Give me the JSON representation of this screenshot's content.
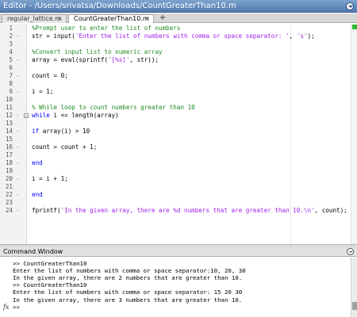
{
  "editor": {
    "title": "Editor - /Users/srivatsa/Downloads/CountGreaterThan10.m",
    "tabs": [
      {
        "label": "regular_lattice.m",
        "close": "×"
      },
      {
        "label": "CountGreaterThan10.m",
        "close": "×"
      }
    ],
    "add_tab": "+",
    "lines": [
      {
        "num": "1",
        "dash": "",
        "parts": [
          {
            "t": "%Prompt user to enter the list of numbers",
            "c": "cmt"
          }
        ]
      },
      {
        "num": "2",
        "dash": "-",
        "parts": [
          {
            "t": "str = input(",
            "c": ""
          },
          {
            "t": "'Enter the list of numbers with comma or space separator: '",
            "c": "str"
          },
          {
            "t": ", ",
            "c": ""
          },
          {
            "t": "'s'",
            "c": "str"
          },
          {
            "t": ");",
            "c": ""
          }
        ]
      },
      {
        "num": "3",
        "dash": "",
        "parts": []
      },
      {
        "num": "4",
        "dash": "",
        "parts": [
          {
            "t": "%Convert input list to numeric array",
            "c": "cmt"
          }
        ]
      },
      {
        "num": "5",
        "dash": "-",
        "parts": [
          {
            "t": "array = eval(sprintf(",
            "c": ""
          },
          {
            "t": "'[%s]'",
            "c": "str"
          },
          {
            "t": ", str));",
            "c": ""
          }
        ]
      },
      {
        "num": "6",
        "dash": "",
        "parts": []
      },
      {
        "num": "7",
        "dash": "-",
        "parts": [
          {
            "t": "count = 0;",
            "c": ""
          }
        ]
      },
      {
        "num": "8",
        "dash": "",
        "parts": []
      },
      {
        "num": "9",
        "dash": "-",
        "parts": [
          {
            "t": "i = 1;",
            "c": ""
          }
        ]
      },
      {
        "num": "10",
        "dash": "",
        "parts": []
      },
      {
        "num": "11",
        "dash": "",
        "parts": [
          {
            "t": "% While loop to count numbers greater than 10",
            "c": "cmt"
          }
        ]
      },
      {
        "num": "12",
        "dash": "-",
        "fold": "−",
        "parts": [
          {
            "t": "while",
            "c": "kw"
          },
          {
            "t": " i <= length(array)",
            "c": ""
          }
        ]
      },
      {
        "num": "13",
        "dash": "",
        "parts": []
      },
      {
        "num": "14",
        "dash": "-",
        "parts": [
          {
            "t": "if",
            "c": "kw"
          },
          {
            "t": " array(i) > 10",
            "c": ""
          }
        ]
      },
      {
        "num": "15",
        "dash": "",
        "parts": []
      },
      {
        "num": "16",
        "dash": "-",
        "parts": [
          {
            "t": "count = count + 1;",
            "c": ""
          }
        ]
      },
      {
        "num": "17",
        "dash": "",
        "parts": []
      },
      {
        "num": "18",
        "dash": "-",
        "parts": [
          {
            "t": "end",
            "c": "kw"
          }
        ]
      },
      {
        "num": "19",
        "dash": "",
        "parts": []
      },
      {
        "num": "20",
        "dash": "-",
        "parts": [
          {
            "t": "i = i + 1;",
            "c": ""
          }
        ]
      },
      {
        "num": "21",
        "dash": "",
        "parts": []
      },
      {
        "num": "22",
        "dash": "-",
        "parts": [
          {
            "t": "end",
            "c": "kw"
          }
        ]
      },
      {
        "num": "23",
        "dash": "",
        "parts": []
      },
      {
        "num": "24",
        "dash": "-",
        "parts": [
          {
            "t": "fprintf(",
            "c": ""
          },
          {
            "t": "'In the given array, there are %d numbers that are greater than 10.\\n'",
            "c": "str"
          },
          {
            "t": ", count);",
            "c": ""
          }
        ]
      }
    ]
  },
  "command_window": {
    "title": "Command Window",
    "fx_label": "fx",
    "lines": [
      ">> CountGreaterThan10",
      "Enter the list of numbers with comma or space separator:10, 20, 30",
      "In the given array, there are 2 numbers that are greater than 10.",
      ">> CountGreaterThan10",
      "Enter the list of numbers with comma or space separator: 15 20 30",
      "In the given array, there are 3 numbers that are greater than 10.",
      ">> "
    ]
  }
}
